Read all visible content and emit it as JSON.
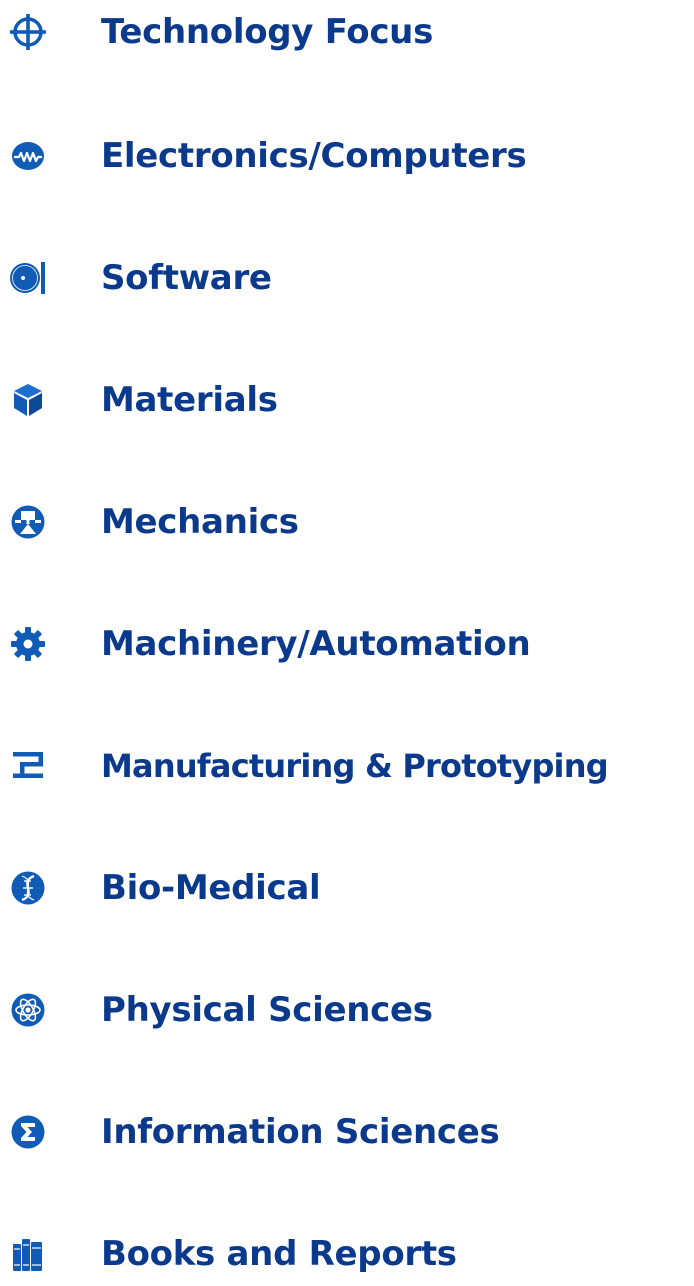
{
  "accent_color": "#0b3a8c",
  "icon_color": "#0f5bb5",
  "categories": [
    {
      "label": "Technology Focus",
      "icon": "crosshair-icon"
    },
    {
      "label": "Electronics/Computers",
      "icon": "circuit-wave-icon"
    },
    {
      "label": "Software",
      "icon": "disc-icon"
    },
    {
      "label": "Materials",
      "icon": "cube-icon"
    },
    {
      "label": "Mechanics",
      "icon": "mechanics-icon"
    },
    {
      "label": "Machinery/Automation",
      "icon": "gear-icon"
    },
    {
      "label": "Manufacturing & Prototyping",
      "icon": "manufacturing-icon"
    },
    {
      "label": "Bio-Medical",
      "icon": "dna-icon"
    },
    {
      "label": "Physical Sciences",
      "icon": "atom-icon"
    },
    {
      "label": "Information Sciences",
      "icon": "sigma-icon"
    },
    {
      "label": "Books and Reports",
      "icon": "books-icon"
    }
  ]
}
